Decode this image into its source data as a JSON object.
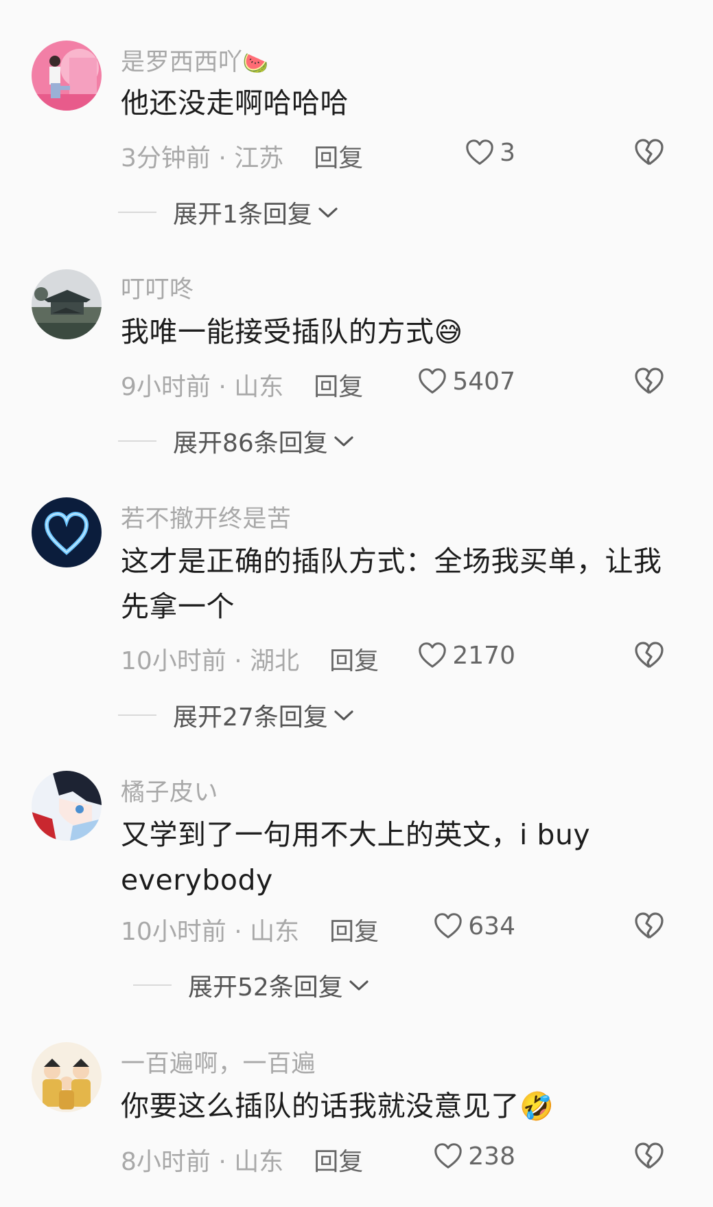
{
  "colors": {
    "background": "#fafafa",
    "username": "#a8a8a8",
    "text": "#1c1c1c",
    "meta": "#a8a8a8",
    "action": "#666666"
  },
  "comments": [
    {
      "username": "是罗西西吖",
      "username_emoji": "🍉",
      "text": "他还没走啊哈哈哈",
      "text_emoji": "",
      "time": "3分钟前",
      "location": "江苏",
      "reply_label": "回复",
      "likes": "3",
      "expand_label": "展开1条回复"
    },
    {
      "username": "叮叮咚",
      "username_emoji": "",
      "text": "我唯一能接受插队的方式",
      "text_emoji": "😅",
      "time": "9小时前",
      "location": "山东",
      "reply_label": "回复",
      "likes": "5407",
      "expand_label": "展开86条回复"
    },
    {
      "username": "若不撤开终是苦",
      "username_emoji": "",
      "text": "这才是正确的插队方式：全场我买单，让我先拿一个",
      "text_emoji": "",
      "time": "10小时前",
      "location": "湖北",
      "reply_label": "回复",
      "likes": "2170",
      "expand_label": "展开27条回复"
    },
    {
      "username": "橘子皮い",
      "username_emoji": "",
      "text": "又学到了一句用不大上的英文，i buy everybody",
      "text_emoji": "",
      "time": "10小时前",
      "location": "山东",
      "reply_label": "回复",
      "likes": "634",
      "expand_label": "展开52条回复"
    },
    {
      "username": "一百遍啊，一百遍",
      "username_emoji": "",
      "text": "你要这么插队的话我就没意见了",
      "text_emoji": "🤣",
      "time": "8小时前",
      "location": "山东",
      "reply_label": "回复",
      "likes": "238",
      "expand_label": ""
    }
  ]
}
